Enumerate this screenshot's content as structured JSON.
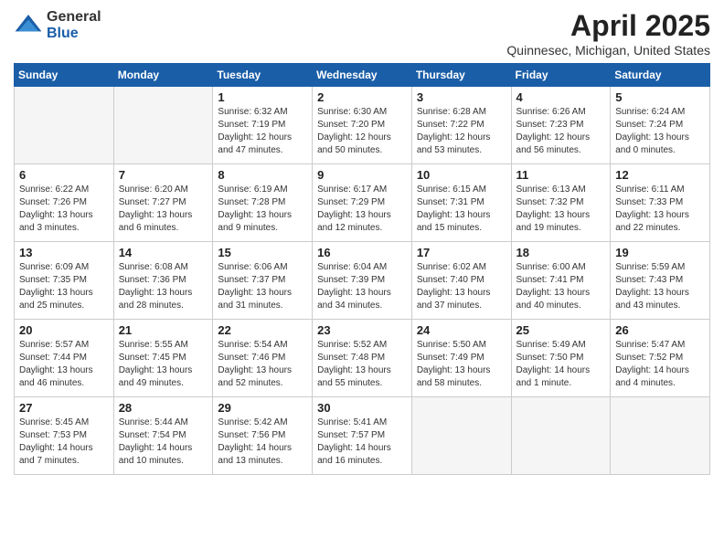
{
  "logo": {
    "general": "General",
    "blue": "Blue"
  },
  "title": "April 2025",
  "subtitle": "Quinnesec, Michigan, United States",
  "days_of_week": [
    "Sunday",
    "Monday",
    "Tuesday",
    "Wednesday",
    "Thursday",
    "Friday",
    "Saturday"
  ],
  "weeks": [
    [
      {
        "day": "",
        "detail": ""
      },
      {
        "day": "",
        "detail": ""
      },
      {
        "day": "1",
        "detail": "Sunrise: 6:32 AM\nSunset: 7:19 PM\nDaylight: 12 hours\nand 47 minutes."
      },
      {
        "day": "2",
        "detail": "Sunrise: 6:30 AM\nSunset: 7:20 PM\nDaylight: 12 hours\nand 50 minutes."
      },
      {
        "day": "3",
        "detail": "Sunrise: 6:28 AM\nSunset: 7:22 PM\nDaylight: 12 hours\nand 53 minutes."
      },
      {
        "day": "4",
        "detail": "Sunrise: 6:26 AM\nSunset: 7:23 PM\nDaylight: 12 hours\nand 56 minutes."
      },
      {
        "day": "5",
        "detail": "Sunrise: 6:24 AM\nSunset: 7:24 PM\nDaylight: 13 hours\nand 0 minutes."
      }
    ],
    [
      {
        "day": "6",
        "detail": "Sunrise: 6:22 AM\nSunset: 7:26 PM\nDaylight: 13 hours\nand 3 minutes."
      },
      {
        "day": "7",
        "detail": "Sunrise: 6:20 AM\nSunset: 7:27 PM\nDaylight: 13 hours\nand 6 minutes."
      },
      {
        "day": "8",
        "detail": "Sunrise: 6:19 AM\nSunset: 7:28 PM\nDaylight: 13 hours\nand 9 minutes."
      },
      {
        "day": "9",
        "detail": "Sunrise: 6:17 AM\nSunset: 7:29 PM\nDaylight: 13 hours\nand 12 minutes."
      },
      {
        "day": "10",
        "detail": "Sunrise: 6:15 AM\nSunset: 7:31 PM\nDaylight: 13 hours\nand 15 minutes."
      },
      {
        "day": "11",
        "detail": "Sunrise: 6:13 AM\nSunset: 7:32 PM\nDaylight: 13 hours\nand 19 minutes."
      },
      {
        "day": "12",
        "detail": "Sunrise: 6:11 AM\nSunset: 7:33 PM\nDaylight: 13 hours\nand 22 minutes."
      }
    ],
    [
      {
        "day": "13",
        "detail": "Sunrise: 6:09 AM\nSunset: 7:35 PM\nDaylight: 13 hours\nand 25 minutes."
      },
      {
        "day": "14",
        "detail": "Sunrise: 6:08 AM\nSunset: 7:36 PM\nDaylight: 13 hours\nand 28 minutes."
      },
      {
        "day": "15",
        "detail": "Sunrise: 6:06 AM\nSunset: 7:37 PM\nDaylight: 13 hours\nand 31 minutes."
      },
      {
        "day": "16",
        "detail": "Sunrise: 6:04 AM\nSunset: 7:39 PM\nDaylight: 13 hours\nand 34 minutes."
      },
      {
        "day": "17",
        "detail": "Sunrise: 6:02 AM\nSunset: 7:40 PM\nDaylight: 13 hours\nand 37 minutes."
      },
      {
        "day": "18",
        "detail": "Sunrise: 6:00 AM\nSunset: 7:41 PM\nDaylight: 13 hours\nand 40 minutes."
      },
      {
        "day": "19",
        "detail": "Sunrise: 5:59 AM\nSunset: 7:43 PM\nDaylight: 13 hours\nand 43 minutes."
      }
    ],
    [
      {
        "day": "20",
        "detail": "Sunrise: 5:57 AM\nSunset: 7:44 PM\nDaylight: 13 hours\nand 46 minutes."
      },
      {
        "day": "21",
        "detail": "Sunrise: 5:55 AM\nSunset: 7:45 PM\nDaylight: 13 hours\nand 49 minutes."
      },
      {
        "day": "22",
        "detail": "Sunrise: 5:54 AM\nSunset: 7:46 PM\nDaylight: 13 hours\nand 52 minutes."
      },
      {
        "day": "23",
        "detail": "Sunrise: 5:52 AM\nSunset: 7:48 PM\nDaylight: 13 hours\nand 55 minutes."
      },
      {
        "day": "24",
        "detail": "Sunrise: 5:50 AM\nSunset: 7:49 PM\nDaylight: 13 hours\nand 58 minutes."
      },
      {
        "day": "25",
        "detail": "Sunrise: 5:49 AM\nSunset: 7:50 PM\nDaylight: 14 hours\nand 1 minute."
      },
      {
        "day": "26",
        "detail": "Sunrise: 5:47 AM\nSunset: 7:52 PM\nDaylight: 14 hours\nand 4 minutes."
      }
    ],
    [
      {
        "day": "27",
        "detail": "Sunrise: 5:45 AM\nSunset: 7:53 PM\nDaylight: 14 hours\nand 7 minutes."
      },
      {
        "day": "28",
        "detail": "Sunrise: 5:44 AM\nSunset: 7:54 PM\nDaylight: 14 hours\nand 10 minutes."
      },
      {
        "day": "29",
        "detail": "Sunrise: 5:42 AM\nSunset: 7:56 PM\nDaylight: 14 hours\nand 13 minutes."
      },
      {
        "day": "30",
        "detail": "Sunrise: 5:41 AM\nSunset: 7:57 PM\nDaylight: 14 hours\nand 16 minutes."
      },
      {
        "day": "",
        "detail": ""
      },
      {
        "day": "",
        "detail": ""
      },
      {
        "day": "",
        "detail": ""
      }
    ]
  ]
}
